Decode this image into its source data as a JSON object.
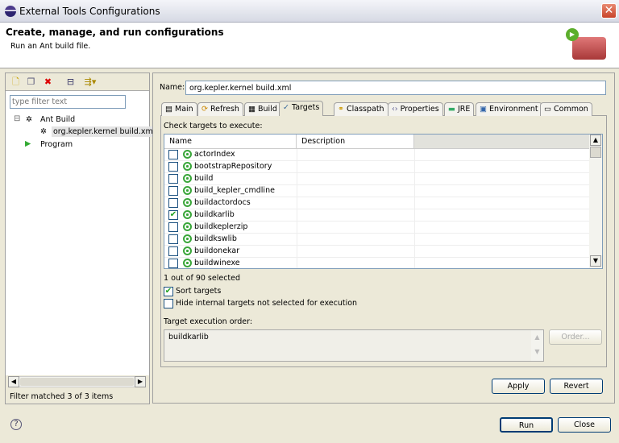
{
  "window": {
    "title": "External Tools Configurations",
    "close": "✕"
  },
  "header": {
    "title": "Create, manage, and run configurations",
    "subtitle": "Run an Ant build file."
  },
  "left": {
    "toolbar": [
      "new-config-icon",
      "duplicate-icon",
      "delete-icon",
      "collapse-all-icon",
      "filter-icon"
    ],
    "filter_placeholder": "type filter text",
    "tree": [
      {
        "label": "Ant Build",
        "expander": "⊟"
      },
      {
        "label": "org.kepler.kernel build.xml"
      },
      {
        "label": "Program"
      }
    ],
    "status": "Filter matched 3 of 3 items"
  },
  "right": {
    "name_label": "Name:",
    "name_value": "org.kepler.kernel build.xml",
    "tabs": [
      "Main",
      "Refresh",
      "Build",
      "Targets",
      "Classpath",
      "Properties",
      "JRE",
      "Environment",
      "Common"
    ],
    "active_tab": "Targets",
    "check_label": "Check targets to execute:",
    "columns": [
      "Name",
      "Description"
    ],
    "targets": [
      {
        "name": "actorIndex",
        "checked": false
      },
      {
        "name": "bootstrapRepository",
        "checked": false
      },
      {
        "name": "build",
        "checked": false
      },
      {
        "name": "build_kepler_cmdline",
        "checked": false
      },
      {
        "name": "buildactordocs",
        "checked": false
      },
      {
        "name": "buildkarlib",
        "checked": true
      },
      {
        "name": "buildkeplerzip",
        "checked": false
      },
      {
        "name": "buildkswlib",
        "checked": false
      },
      {
        "name": "buildonekar",
        "checked": false
      },
      {
        "name": "buildwinexe",
        "checked": false
      }
    ],
    "selected_count": "1 out of 90 selected",
    "sort_label": "Sort targets",
    "sort_checked": true,
    "hide_label": "Hide internal targets not selected for execution",
    "hide_checked": false,
    "order_label": "Target execution order:",
    "order_value": "buildkarlib",
    "order_button": "Order...",
    "apply": "Apply",
    "revert": "Revert"
  },
  "footer": {
    "help": "?",
    "run": "Run",
    "close": "Close"
  },
  "colors": {
    "accent_border": "#7f9db9",
    "dialog_bg": "#ece9d8",
    "target_green": "#3aa63a"
  }
}
